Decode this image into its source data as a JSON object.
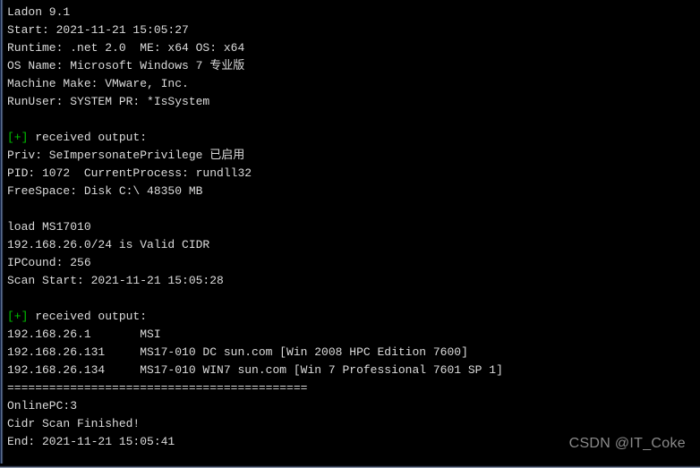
{
  "window": {
    "type": "console-terminal",
    "background_color": "#000000",
    "text_color": "#dcdcdc",
    "accent_color": "#00c000",
    "rail_color": "#15264a"
  },
  "terminal": {
    "lines": [
      {
        "id": "banner",
        "kind": "text",
        "text": "Ladon 9.1"
      },
      {
        "id": "start-time",
        "kind": "text",
        "text": "Start: 2021-11-21 15:05:27"
      },
      {
        "id": "runtime",
        "kind": "text",
        "text": "Runtime: .net 2.0  ME: x64 OS: x64"
      },
      {
        "id": "os-name",
        "kind": "text",
        "text": "OS Name: Microsoft Windows 7 专业版"
      },
      {
        "id": "machine-make",
        "kind": "text",
        "text": "Machine Make: VMware, Inc."
      },
      {
        "id": "run-user",
        "kind": "text",
        "text": "RunUser: SYSTEM PR: *IsSystem"
      },
      {
        "id": "blank-1",
        "kind": "blank",
        "text": ""
      },
      {
        "id": "received-1",
        "kind": "marker",
        "marker": "[+]",
        "text": " received output:"
      },
      {
        "id": "priv",
        "kind": "text",
        "text": "Priv: SeImpersonatePrivilege 已启用"
      },
      {
        "id": "pid",
        "kind": "text",
        "text": "PID: 1072  CurrentProcess: rundll32"
      },
      {
        "id": "freespace",
        "kind": "text",
        "text": "FreeSpace: Disk C:\\ 48350 MB"
      },
      {
        "id": "blank-2",
        "kind": "blank",
        "text": ""
      },
      {
        "id": "load-module",
        "kind": "text",
        "text": "load MS17010"
      },
      {
        "id": "cidr-valid",
        "kind": "text",
        "text": "192.168.26.0/24 is Valid CIDR"
      },
      {
        "id": "ip-count",
        "kind": "text",
        "text": "IPCound: 256"
      },
      {
        "id": "scan-start",
        "kind": "text",
        "text": "Scan Start: 2021-11-21 15:05:28"
      },
      {
        "id": "blank-3",
        "kind": "blank",
        "text": ""
      },
      {
        "id": "received-2",
        "kind": "marker",
        "marker": "[+]",
        "text": " received output:"
      },
      {
        "id": "result-1",
        "kind": "text",
        "text": "192.168.26.1       MSI"
      },
      {
        "id": "result-2",
        "kind": "text",
        "text": "192.168.26.131     MS17-010 DC sun.com [Win 2008 HPC Edition 7600]"
      },
      {
        "id": "result-3",
        "kind": "text",
        "text": "192.168.26.134     MS17-010 WIN7 sun.com [Win 7 Professional 7601 SP 1]"
      },
      {
        "id": "separator",
        "kind": "text",
        "text": "==========================================="
      },
      {
        "id": "online-pc",
        "kind": "text",
        "text": "OnlinePC:3"
      },
      {
        "id": "scan-finished",
        "kind": "text",
        "text": "Cidr Scan Finished!"
      },
      {
        "id": "end-time",
        "kind": "text",
        "text": "End: 2021-11-21 15:05:41"
      }
    ]
  },
  "scan_results": {
    "target_cidr": "192.168.26.0/24",
    "ip_count": 256,
    "online_pc": 3,
    "module": "MS17010",
    "hosts": [
      {
        "ip": "192.168.26.1",
        "vuln": "",
        "hostname": "MSI",
        "domain": "",
        "os": ""
      },
      {
        "ip": "192.168.26.131",
        "vuln": "MS17-010",
        "hostname": "DC",
        "domain": "sun.com",
        "os": "[Win 2008 HPC Edition 7600]"
      },
      {
        "ip": "192.168.26.134",
        "vuln": "MS17-010",
        "hostname": "WIN7",
        "domain": "sun.com",
        "os": "[Win 7 Professional 7601 SP 1]"
      }
    ]
  },
  "watermark": {
    "text": "CSDN @IT_Coke"
  }
}
